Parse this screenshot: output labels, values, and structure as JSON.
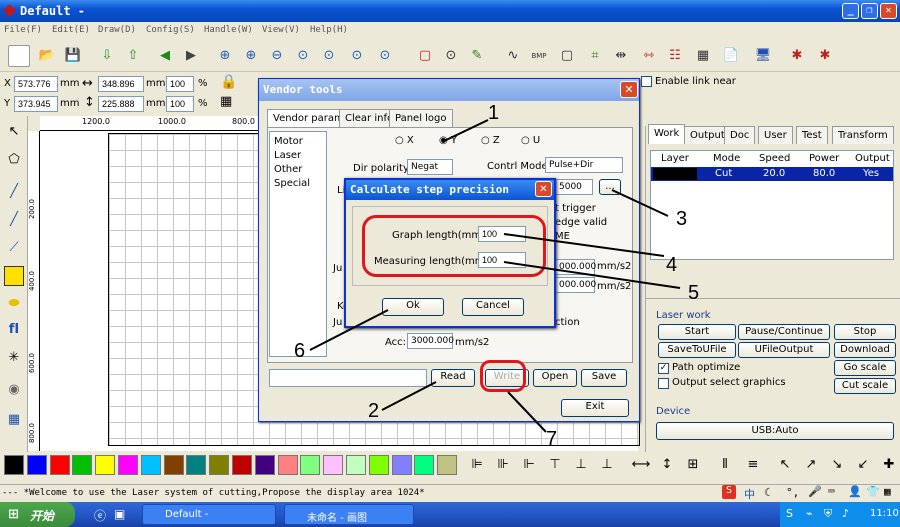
{
  "window": {
    "title": "Default -"
  },
  "menu": [
    "File(F)",
    "Edit(E)",
    "Draw(D)",
    "Config(S)",
    "Handle(W)",
    "View(V)",
    "Help(H)"
  ],
  "coords": {
    "x_label": "X",
    "x_value": "573.776",
    "x_unit": "mm",
    "y_label": "Y",
    "y_value": "373.945",
    "y_unit": "mm",
    "w_value": "348.896",
    "w_unit": "mm",
    "h_value": "225.888",
    "h_unit": "mm",
    "xpct": "100",
    "ypct": "100",
    "pct": "%",
    "enable_link": "Enable link near"
  },
  "rulers": {
    "top": [
      "1200.0",
      "1000.0",
      "800.0"
    ],
    "left": [
      "200.0",
      "400.0",
      "600.0",
      "800.0"
    ]
  },
  "right_panel": {
    "tabs": [
      "Work",
      "Output",
      "Doc",
      "User",
      "Test",
      "Transform"
    ],
    "table_headers": [
      "Layer",
      "Mode",
      "Speed",
      "Power",
      "Output"
    ],
    "row": {
      "mode": "Cut",
      "speed": "20.0",
      "power": "80.0",
      "output": "Yes"
    },
    "laser_work_title": "Laser work",
    "buttons": [
      "Start",
      "Pause/Continue",
      "Stop",
      "SaveToUFile",
      "UFileOutput",
      "Download"
    ],
    "path_optimize": "Path optimize",
    "output_select": "Output select graphics",
    "go_scale": "Go scale",
    "cut_scale": "Cut scale",
    "device_title": "Device",
    "device_value": "USB:Auto"
  },
  "vendor": {
    "title": "Vendor tools",
    "tabs": [
      "Vendor param",
      "Clear info",
      "Panel logo"
    ],
    "tree": [
      "Motor",
      "Laser",
      "Other",
      "Special"
    ],
    "axes": [
      "X",
      "Y",
      "Z",
      "U"
    ],
    "dir_polarity_label": "Dir polarity:",
    "dir_polarity_value": "Negat",
    "control_mode_label": "Contrl Mode:",
    "control_mode_value": "Pulse+Dir",
    "step_value": "5000",
    "step_btn": "...",
    "limit_frag": "Li",
    "trigger_frag": "t trigger",
    "edge_frag": "edge valid",
    "me_frag": "ME",
    "ju1": "Ju",
    "ju2": "Ju",
    "ke": "Ke",
    "ction": "ction",
    "speed1": "000.000",
    "speed1_unit": "mm/s2",
    "speed2": "000.000",
    "speed2_unit": "mm/s2",
    "acc_label": "Acc:",
    "acc_value": "3000.000",
    "acc_unit": "mm/s2",
    "read": "Read",
    "write": "Write",
    "open": "Open",
    "save": "Save",
    "exit": "Exit"
  },
  "calc": {
    "title": "Calculate step precision",
    "graph_label": "Graph length(mm):",
    "graph_value": "100",
    "measure_label": "Measuring length(mm):",
    "measure_value": "100",
    "ok": "Ok",
    "cancel": "Cancel"
  },
  "callouts": [
    "1",
    "2",
    "3",
    "4",
    "5",
    "6",
    "7"
  ],
  "status": "--- *Welcome to use the Laser system of cutting,Propose the display area 1024*",
  "taskbar": {
    "start": "开始",
    "task1": "Default -",
    "task2": "未命名 - 画图",
    "time": "11:10"
  },
  "palette_colors": [
    "#000000",
    "#0000ff",
    "#ff0000",
    "#00c000",
    "#ffff00",
    "#ff00ff",
    "#00c0ff",
    "#804000",
    "#008080",
    "#808000",
    "#c00000",
    "#400080",
    "#ff8080",
    "#80ff80",
    "#ffc0ff",
    "#c0ffc0",
    "#80ff00",
    "#8080ff",
    "#00ff80",
    "#c0c080"
  ]
}
